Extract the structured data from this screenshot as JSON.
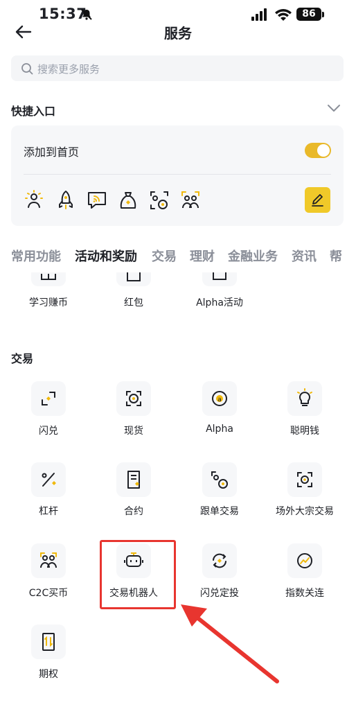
{
  "status_bar": {
    "time": "15:37",
    "battery": "86"
  },
  "nav": {
    "title": "服务"
  },
  "search": {
    "placeholder": "搜索更多服务"
  },
  "quick_entry": {
    "title": "快捷入口",
    "add_to_home": "添加到首页",
    "toggle_on": true,
    "icons": [
      "sun-person-icon",
      "rocket-icon",
      "chat-feed-icon",
      "money-bag-icon",
      "spot-exchange-icon",
      "c2c-users-icon"
    ]
  },
  "tabs": [
    "常用功能",
    "活动和奖励",
    "交易",
    "理财",
    "金融业务",
    "资讯",
    "帮"
  ],
  "active_tab": "活动和奖励",
  "rewards_row": [
    "学习赚币",
    "红包",
    "Alpha活动"
  ],
  "trade_section": {
    "title": "交易",
    "items": [
      "闪兑",
      "现货",
      "Alpha",
      "聪明钱",
      "杠杆",
      "合约",
      "跟单交易",
      "场外大宗交易",
      "C2C买币",
      "交易机器人",
      "闪兑定投",
      "指数关连",
      "期权"
    ]
  },
  "colors": {
    "accent": "#F0B90B",
    "annotation": "#E8352F"
  }
}
